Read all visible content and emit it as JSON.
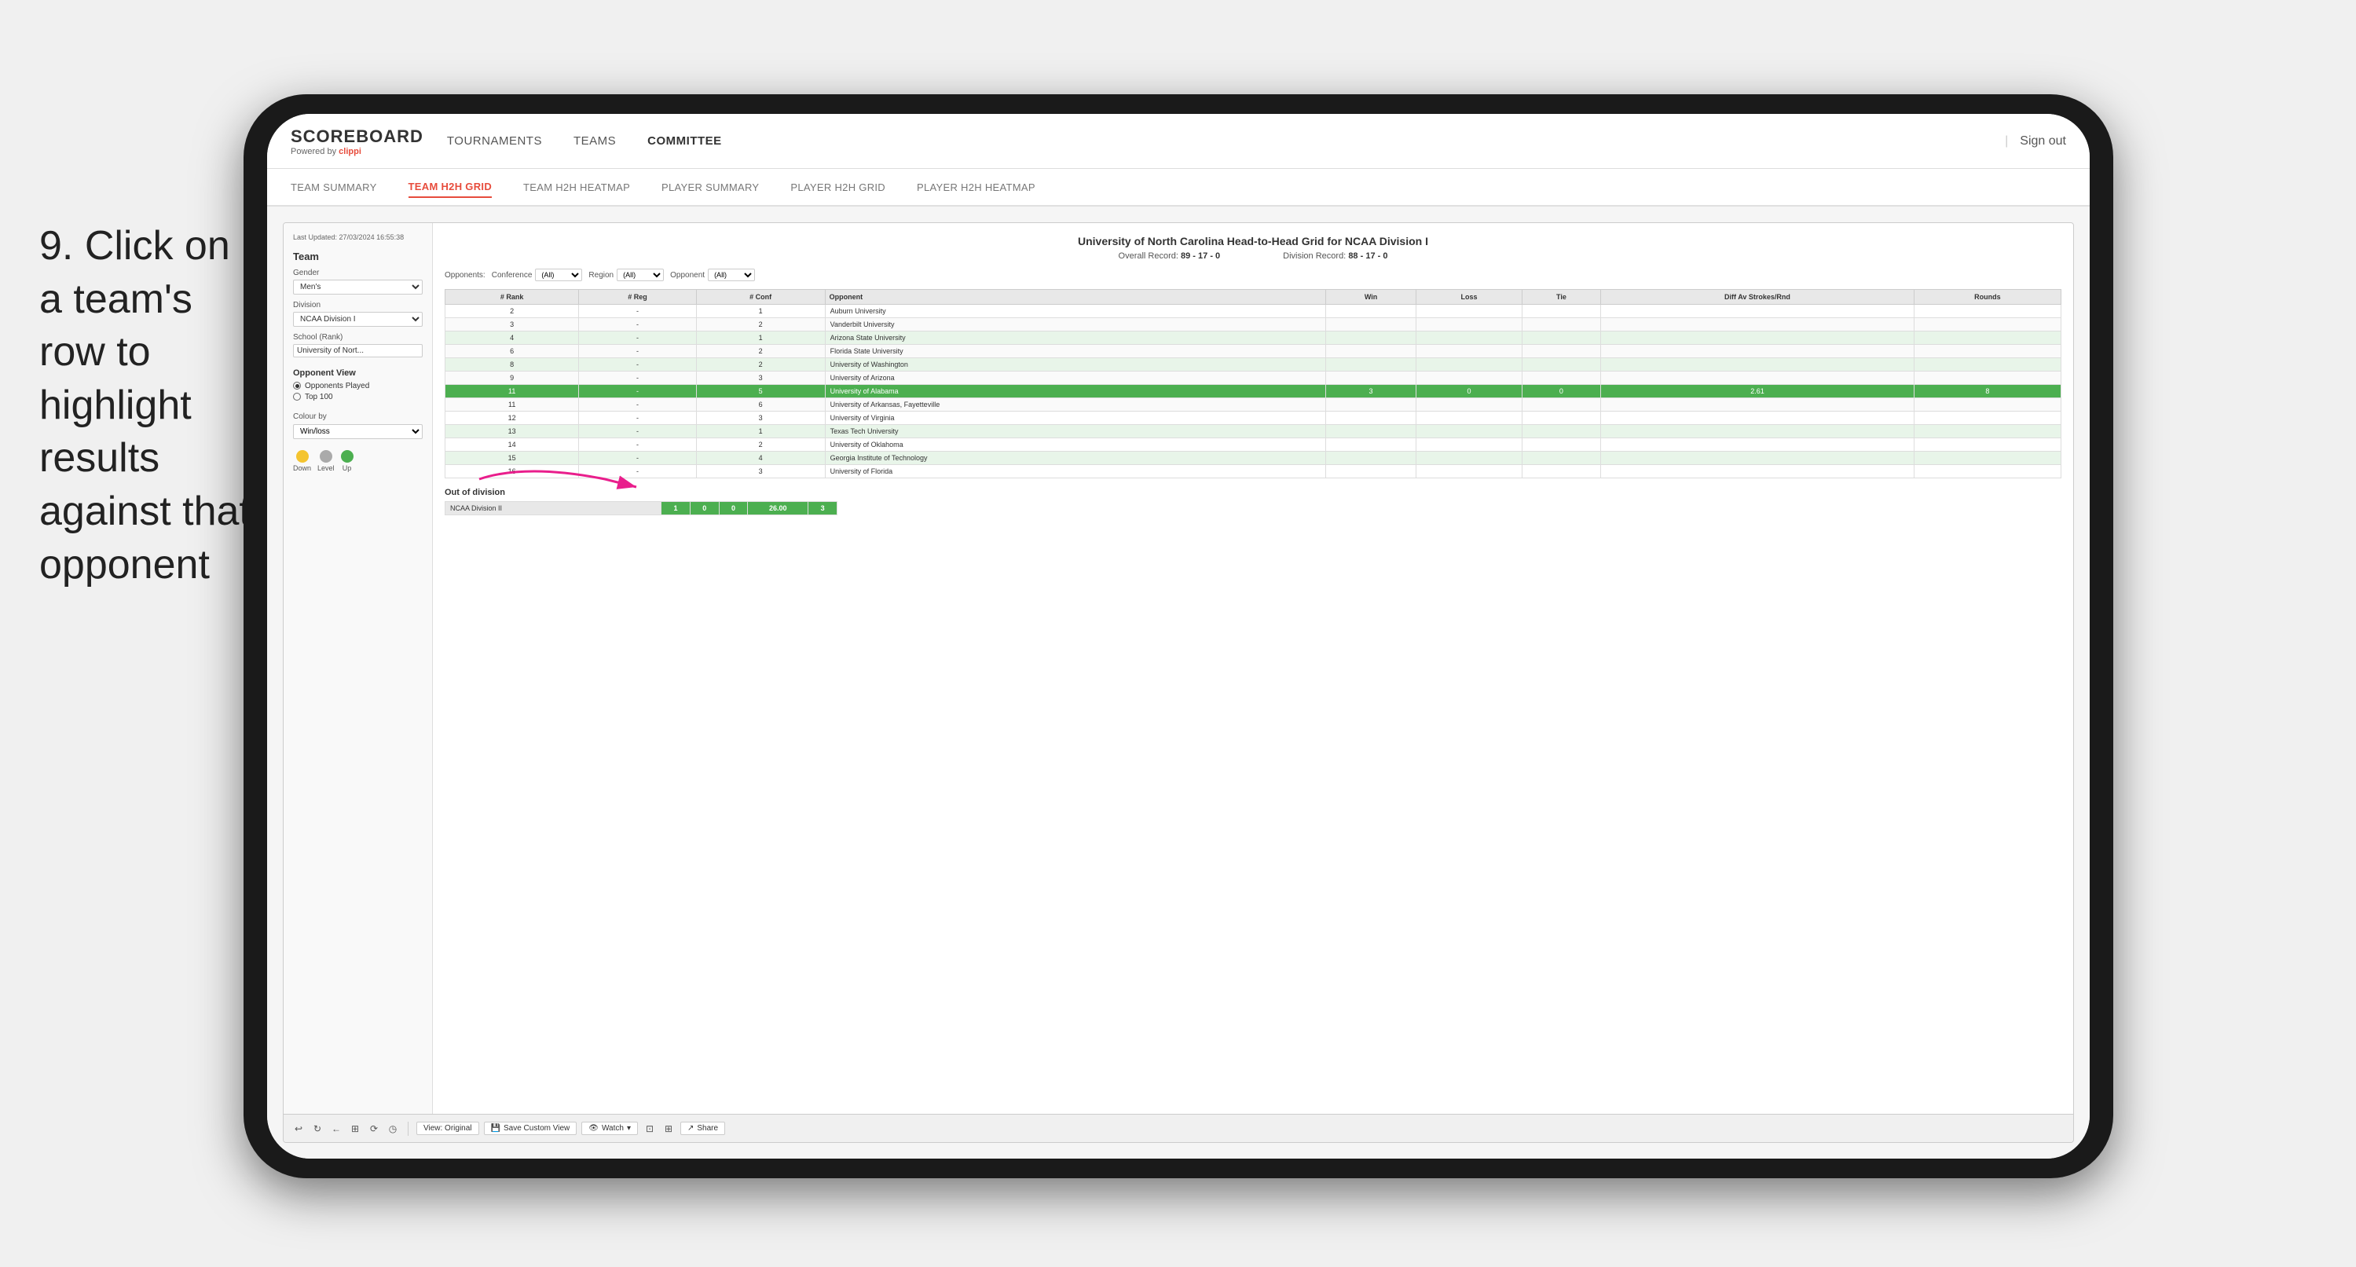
{
  "instruction": {
    "number": "9.",
    "text": "Click on a team's row to highlight results against that opponent"
  },
  "nav": {
    "logo": "SCOREBOARD",
    "powered_by": "Powered by ",
    "clippi": "clippi",
    "items": [
      "TOURNAMENTS",
      "TEAMS",
      "COMMITTEE"
    ],
    "active_item": "COMMITTEE",
    "sign_out": "Sign out"
  },
  "sub_nav": {
    "items": [
      "TEAM SUMMARY",
      "TEAM H2H GRID",
      "TEAM H2H HEATMAP",
      "PLAYER SUMMARY",
      "PLAYER H2H GRID",
      "PLAYER H2H HEATMAP"
    ],
    "active": "TEAM H2H GRID"
  },
  "left_panel": {
    "last_updated": "Last Updated: 27/03/2024\n16:55:38",
    "team_label": "Team",
    "gender_label": "Gender",
    "gender_value": "Men's",
    "division_label": "Division",
    "division_value": "NCAA Division I",
    "school_label": "School (Rank)",
    "school_value": "University of Nort...",
    "opponent_view_label": "Opponent View",
    "opponents_played": "Opponents Played",
    "top_100": "Top 100",
    "colour_by_label": "Colour by",
    "colour_by_value": "Win/loss",
    "legend": {
      "down_label": "Down",
      "level_label": "Level",
      "up_label": "Up",
      "down_color": "#f4c430",
      "level_color": "#aaa",
      "up_color": "#4caf50"
    }
  },
  "grid": {
    "title": "University of North Carolina Head-to-Head Grid for NCAA Division I",
    "overall_record_label": "Overall Record:",
    "overall_record": "89 - 17 - 0",
    "division_record_label": "Division Record:",
    "division_record": "88 - 17 - 0",
    "filters": {
      "opponents_label": "Opponents:",
      "conference_label": "Conference",
      "conference_value": "(All)",
      "region_label": "Region",
      "region_value": "(All)",
      "opponent_label": "Opponent",
      "opponent_value": "(All)"
    },
    "table_headers": [
      "# Rank",
      "# Reg",
      "# Conf",
      "Opponent",
      "Win",
      "Loss",
      "Tie",
      "Diff Av Strokes/Rnd",
      "Rounds"
    ],
    "rows": [
      {
        "rank": "2",
        "reg": "-",
        "conf": "1",
        "opponent": "Auburn University",
        "win": "",
        "loss": "",
        "tie": "",
        "diff": "",
        "rounds": "",
        "style": "normal"
      },
      {
        "rank": "3",
        "reg": "-",
        "conf": "2",
        "opponent": "Vanderbilt University",
        "win": "",
        "loss": "",
        "tie": "",
        "diff": "",
        "rounds": "",
        "style": "normal"
      },
      {
        "rank": "4",
        "reg": "-",
        "conf": "1",
        "opponent": "Arizona State University",
        "win": "",
        "loss": "",
        "tie": "",
        "diff": "",
        "rounds": "",
        "style": "light-green"
      },
      {
        "rank": "6",
        "reg": "-",
        "conf": "2",
        "opponent": "Florida State University",
        "win": "",
        "loss": "",
        "tie": "",
        "diff": "",
        "rounds": "",
        "style": "normal"
      },
      {
        "rank": "8",
        "reg": "-",
        "conf": "2",
        "opponent": "University of Washington",
        "win": "",
        "loss": "",
        "tie": "",
        "diff": "",
        "rounds": "",
        "style": "light-green"
      },
      {
        "rank": "9",
        "reg": "-",
        "conf": "3",
        "opponent": "University of Arizona",
        "win": "",
        "loss": "",
        "tie": "",
        "diff": "",
        "rounds": "",
        "style": "normal"
      },
      {
        "rank": "11",
        "reg": "-",
        "conf": "5",
        "opponent": "University of Alabama",
        "win": "3",
        "loss": "0",
        "tie": "0",
        "diff": "2.61",
        "rounds": "8",
        "style": "highlighted"
      },
      {
        "rank": "11",
        "reg": "-",
        "conf": "6",
        "opponent": "University of Arkansas, Fayetteville",
        "win": "",
        "loss": "",
        "tie": "",
        "diff": "",
        "rounds": "",
        "style": "normal"
      },
      {
        "rank": "12",
        "reg": "-",
        "conf": "3",
        "opponent": "University of Virginia",
        "win": "",
        "loss": "",
        "tie": "",
        "diff": "",
        "rounds": "",
        "style": "normal"
      },
      {
        "rank": "13",
        "reg": "-",
        "conf": "1",
        "opponent": "Texas Tech University",
        "win": "",
        "loss": "",
        "tie": "",
        "diff": "",
        "rounds": "",
        "style": "light-green"
      },
      {
        "rank": "14",
        "reg": "-",
        "conf": "2",
        "opponent": "University of Oklahoma",
        "win": "",
        "loss": "",
        "tie": "",
        "diff": "",
        "rounds": "",
        "style": "normal"
      },
      {
        "rank": "15",
        "reg": "-",
        "conf": "4",
        "opponent": "Georgia Institute of Technology",
        "win": "",
        "loss": "",
        "tie": "",
        "diff": "",
        "rounds": "",
        "style": "light-green"
      },
      {
        "rank": "16",
        "reg": "-",
        "conf": "3",
        "opponent": "University of Florida",
        "win": "",
        "loss": "",
        "tie": "",
        "diff": "",
        "rounds": "",
        "style": "normal"
      }
    ],
    "out_of_division": {
      "title": "Out of division",
      "label": "NCAA Division II",
      "win": "1",
      "loss": "0",
      "tie": "0",
      "diff": "26.00",
      "rounds": "3"
    }
  },
  "toolbar": {
    "view_original": "View: Original",
    "save_custom": "Save Custom View",
    "watch": "Watch",
    "share": "Share"
  }
}
